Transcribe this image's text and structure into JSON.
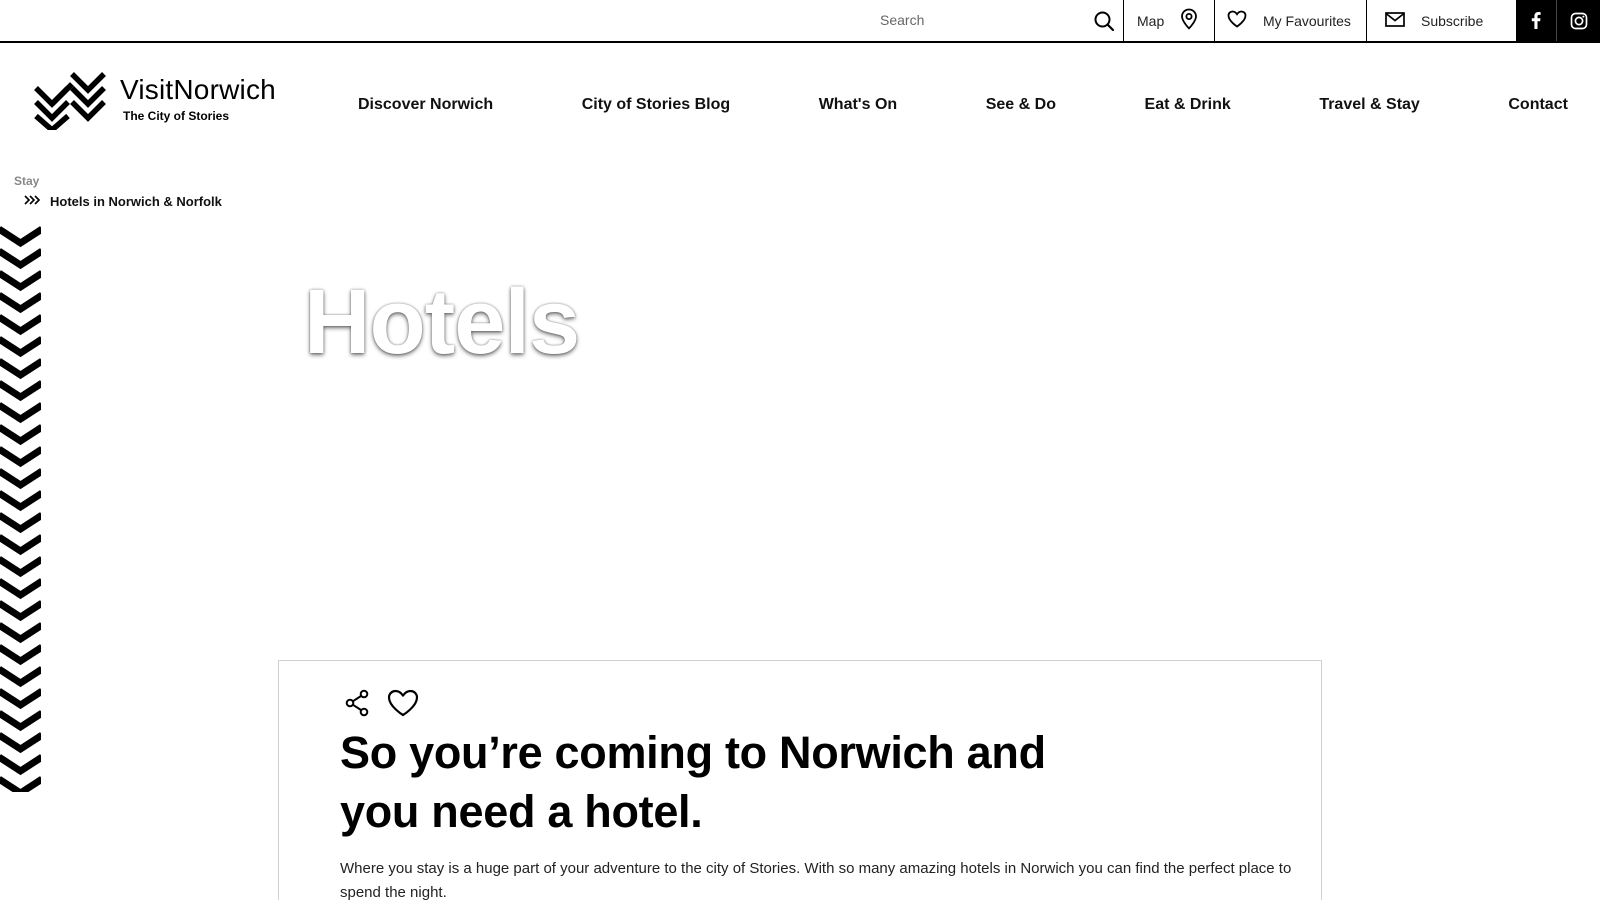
{
  "topbar": {
    "search_placeholder": "Search",
    "map_label": "Map",
    "favourites_label": "My Favourites",
    "subscribe_label": "Subscribe",
    "social": [
      "facebook-icon",
      "instagram-icon"
    ]
  },
  "logo": {
    "name": "VisitNorwich",
    "tagline": "The City of Stories"
  },
  "nav": {
    "items": [
      "Discover Norwich",
      "City of Stories Blog",
      "What's On",
      "See & Do",
      "Eat & Drink",
      "Travel & Stay",
      "Contact"
    ]
  },
  "breadcrumb": {
    "parent": "Stay",
    "current": "Hotels in Norwich & Norfolk"
  },
  "hero": {
    "title": "Hotels"
  },
  "card": {
    "heading": "So you’re coming to Norwich and you need a hotel.",
    "body": "Where you stay is a huge part of your adventure to the city of Stories. With so many amazing hotels in Norwich you can find the perfect place to spend the night."
  },
  "colors": {
    "ink": "#000000",
    "background": "#ffffff",
    "muted": "#888888",
    "card_border": "#cfcfcf"
  }
}
